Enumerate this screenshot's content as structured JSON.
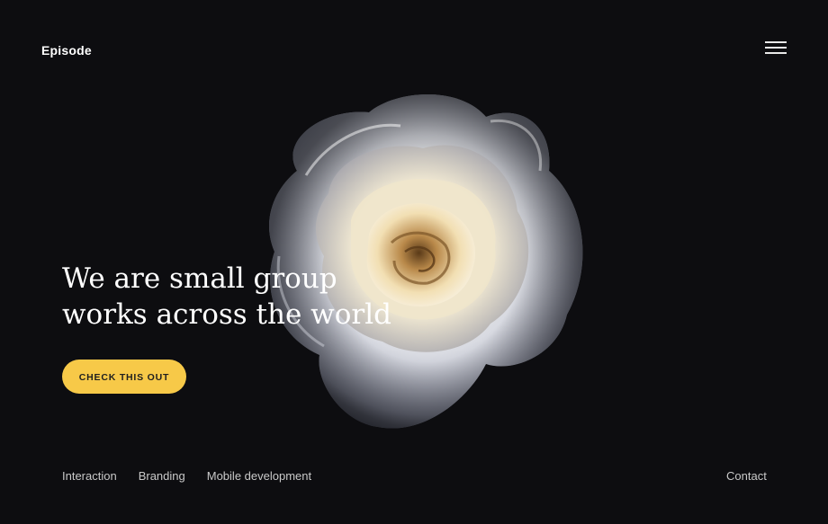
{
  "brand": {
    "name": "Episode"
  },
  "header": {
    "menu_icon": "hamburger-menu-icon"
  },
  "hero": {
    "headline_line1": "We are small group",
    "headline_line2": "works across the world",
    "cta_label": "CHECK THIS OUT",
    "image": "white-rose"
  },
  "footer": {
    "links": [
      "Interaction",
      "Branding",
      "Mobile development"
    ],
    "contact": "Contact"
  },
  "colors": {
    "background": "#0d0d10",
    "accent": "#f7c948",
    "text": "#ffffff",
    "muted_text": "#c9c9c9"
  }
}
